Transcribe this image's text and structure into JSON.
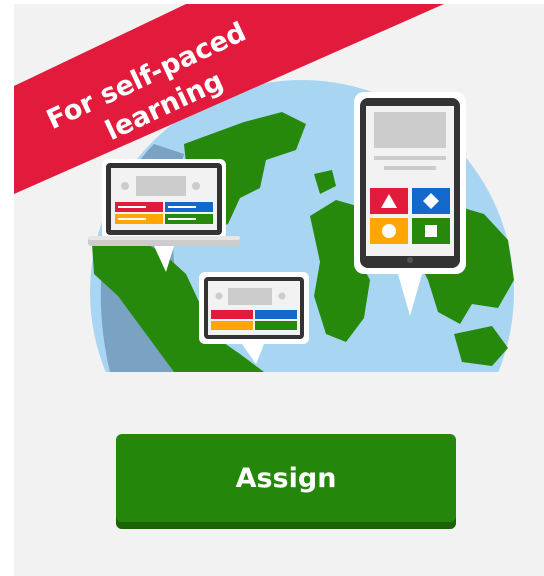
{
  "ribbon": {
    "line1": "For self-paced",
    "line2": "learning"
  },
  "assign_button": {
    "label": "Assign"
  },
  "colors": {
    "card_background": "#f2f2f2",
    "ribbon": "#e21b3c",
    "button": "#25860c",
    "button_shadow": "#1b6306",
    "ocean": "#a8d6f2",
    "land": "#26890c",
    "device_frame": "#333333",
    "answer_red": "#e21b3c",
    "answer_blue": "#1368ce",
    "answer_yellow": "#ffa602",
    "answer_green": "#26890c"
  },
  "icons": [
    "triangle-icon",
    "diamond-icon",
    "circle-icon",
    "square-icon"
  ]
}
